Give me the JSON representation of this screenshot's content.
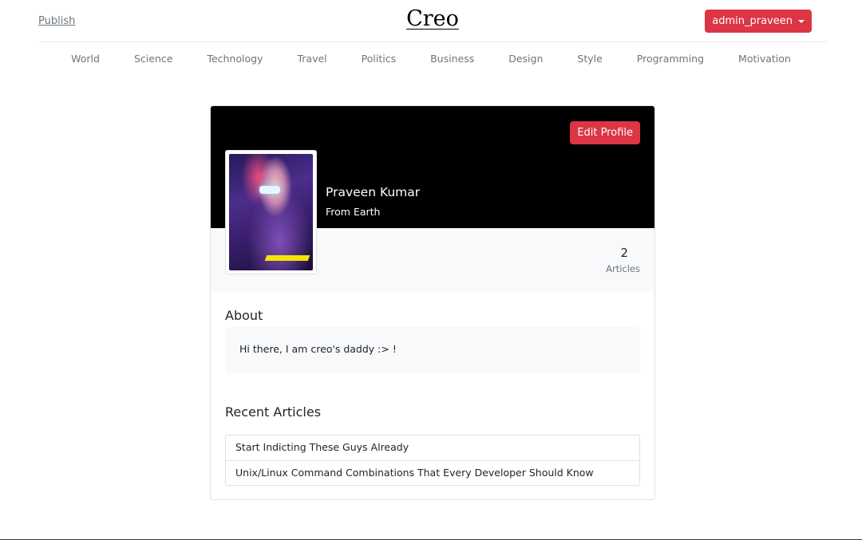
{
  "header": {
    "publish_label": "Publish",
    "brand": "Creo",
    "user_menu_label": "admin_praveen"
  },
  "nav": {
    "items": [
      "World",
      "Science",
      "Technology",
      "Travel",
      "Politics",
      "Business",
      "Design",
      "Style",
      "Programming",
      "Motivation"
    ]
  },
  "profile": {
    "edit_label": "Edit Profile",
    "name": "Praveen Kumar",
    "location": "From Earth",
    "avatar_icon": "cyberpunk-avatar-image",
    "stats": {
      "count": "2",
      "label": "Articles"
    }
  },
  "about": {
    "heading": "About",
    "text": "Hi there, I am creo's daddy :> !"
  },
  "recent": {
    "heading": "Recent Articles",
    "articles": [
      "Start Indicting These Guys Already",
      "Unix/Linux Command Combinations That Every Developer Should Know"
    ]
  },
  "colors": {
    "accent": "#dc3545",
    "cover": "#000000",
    "muted": "#6c757d",
    "panel": "#f8f9fa"
  }
}
